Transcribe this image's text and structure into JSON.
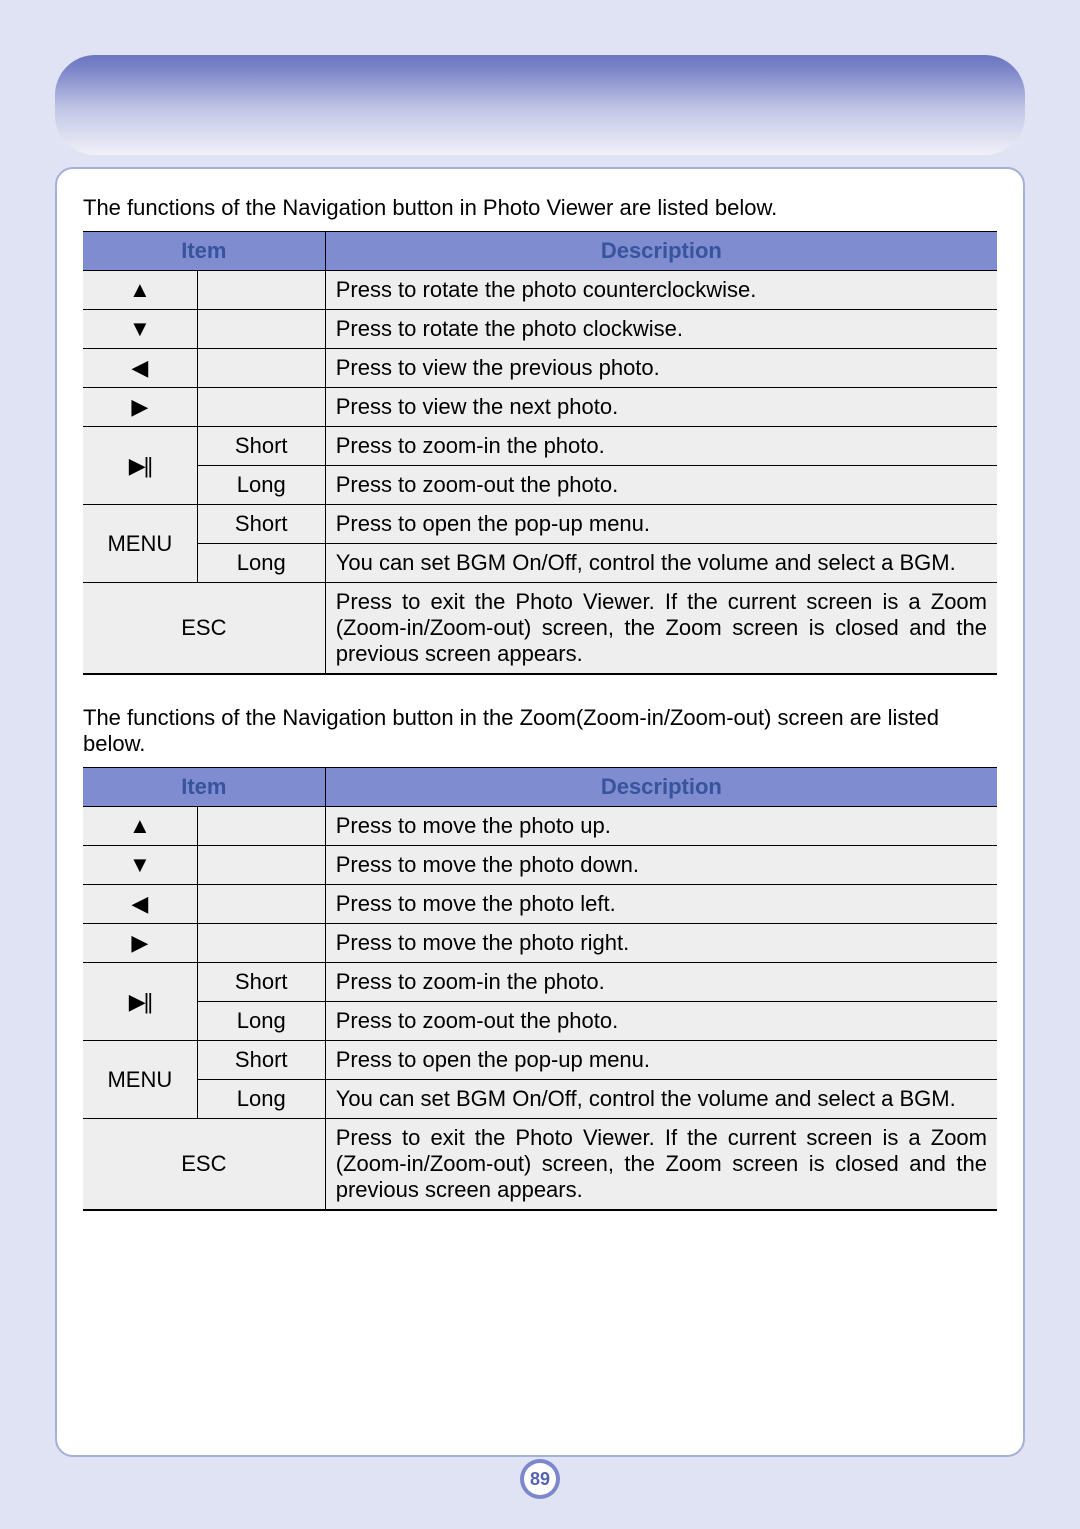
{
  "page_number": "89",
  "table_headers": {
    "item": "Item",
    "description": "Description"
  },
  "tables": [
    {
      "intro": "The functions of the Navigation button in Photo Viewer are listed below.",
      "rows": [
        {
          "icon": "▲",
          "icon_name": "up-arrow-icon",
          "sub": "",
          "desc": "Press to rotate the photo counterclockwise."
        },
        {
          "icon": "▼",
          "icon_name": "down-arrow-icon",
          "sub": "",
          "desc": "Press to rotate the photo clockwise."
        },
        {
          "icon": "◀",
          "icon_name": "left-arrow-icon",
          "sub": "",
          "desc": "Press to view the previous photo."
        },
        {
          "icon": "▶",
          "icon_name": "right-arrow-icon",
          "sub": "",
          "desc": "Press to view the next photo."
        },
        {
          "icon": "▶||",
          "icon_name": "play-pause-icon",
          "sub": "Short",
          "desc": "Press to zoom-in the photo.",
          "rowspan_icon": 2
        },
        {
          "sub": "Long",
          "desc": "Press to zoom-out the photo."
        },
        {
          "icon": "MENU",
          "icon_name": "menu-label",
          "sub": "Short",
          "desc": "Press to open the pop-up menu.",
          "rowspan_icon": 2
        },
        {
          "sub": "Long",
          "desc": "You can set BGM On/Off, control the volume and select a BGM."
        },
        {
          "icon": "ESC",
          "icon_name": "esc-label",
          "colspan_item": 2,
          "desc": "Press to exit the Photo Viewer. If the current screen is a Zoom (Zoom-in/Zoom-out) screen, the Zoom screen is closed and the previous screen appears.",
          "justify": true,
          "last": true
        }
      ]
    },
    {
      "intro": "The functions of the Navigation button in the Zoom(Zoom-in/Zoom-out) screen are listed below.",
      "rows": [
        {
          "icon": "▲",
          "icon_name": "up-arrow-icon",
          "sub": "",
          "desc": "Press to move the photo up."
        },
        {
          "icon": "▼",
          "icon_name": "down-arrow-icon",
          "sub": "",
          "desc": "Press to move the photo down."
        },
        {
          "icon": "◀",
          "icon_name": "left-arrow-icon",
          "sub": "",
          "desc": "Press to move the photo left."
        },
        {
          "icon": "▶",
          "icon_name": "right-arrow-icon",
          "sub": "",
          "desc": "Press to move the photo right."
        },
        {
          "icon": "▶||",
          "icon_name": "play-pause-icon",
          "sub": "Short",
          "desc": "Press to zoom-in the photo.",
          "rowspan_icon": 2
        },
        {
          "sub": "Long",
          "desc": "Press to zoom-out the photo."
        },
        {
          "icon": "MENU",
          "icon_name": "menu-label",
          "sub": "Short",
          "desc": "Press to open the pop-up menu.",
          "rowspan_icon": 2
        },
        {
          "sub": "Long",
          "desc": "You can set BGM On/Off, control the volume and select a BGM."
        },
        {
          "icon": "ESC",
          "icon_name": "esc-label",
          "colspan_item": 2,
          "desc": "Press to exit the Photo Viewer. If the current screen is a Zoom (Zoom-in/Zoom-out) screen, the Zoom screen is closed and the previous screen appears.",
          "justify": true,
          "last": true
        }
      ]
    }
  ]
}
